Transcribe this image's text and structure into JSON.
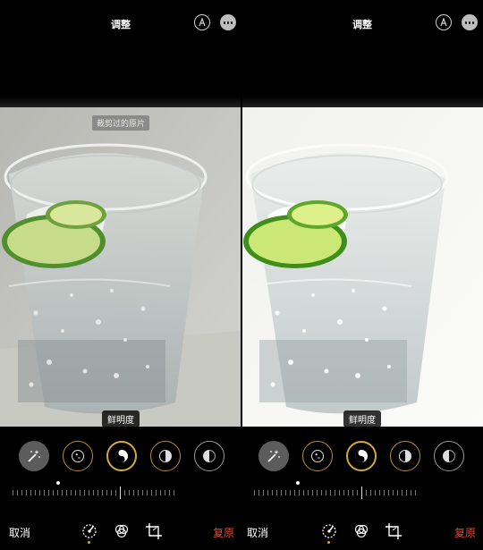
{
  "panels": [
    {
      "header": {
        "title": "调整",
        "auto_icon": "auto-enhance-icon",
        "more_icon": "more-ellipsis-icon"
      },
      "overlay_label": "裁剪过的原片",
      "adjustment_label": "鲜明度",
      "tools": [
        "magic-wand-icon",
        "exposure-icon",
        "brilliance-icon",
        "highlights-icon",
        "shadows-icon"
      ],
      "bottom": {
        "cancel": "取消",
        "revert": "复原",
        "icons": [
          "adjust-dial-icon",
          "filters-icon",
          "crop-icon"
        ]
      }
    },
    {
      "header": {
        "title": "调整",
        "auto_icon": "auto-enhance-icon",
        "more_icon": "more-ellipsis-icon"
      },
      "adjustment_label": "鲜明度",
      "tools": [
        "magic-wand-icon",
        "exposure-icon",
        "brilliance-icon",
        "highlights-icon",
        "shadows-icon"
      ],
      "bottom": {
        "cancel": "取消",
        "revert": "复原",
        "icons": [
          "adjust-dial-icon",
          "filters-icon",
          "crop-icon"
        ]
      }
    }
  ],
  "colors": {
    "accent_gold": "#d4a93a",
    "revert_red": "#e04a34",
    "background": "#000000"
  }
}
